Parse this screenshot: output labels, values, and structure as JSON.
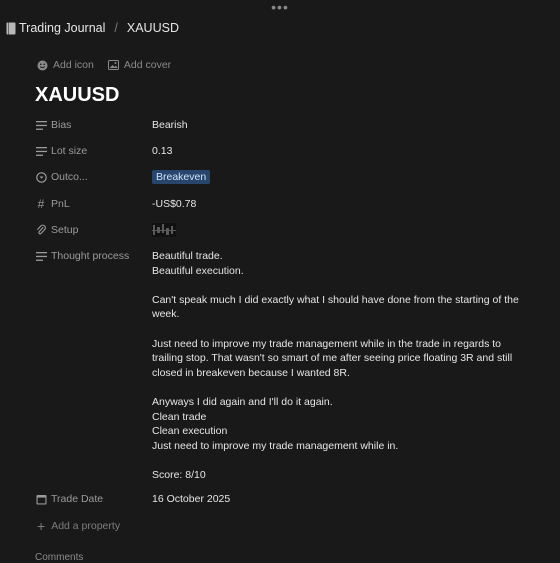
{
  "breadcrumb": {
    "parent": "Trading Journal",
    "separator": "/",
    "current": "XAUUSD"
  },
  "page_actions": {
    "add_icon": "Add icon",
    "add_cover": "Add cover"
  },
  "title": "XAUUSD",
  "properties": {
    "bias": {
      "label": "Bias",
      "value": "Bearish"
    },
    "lot_size": {
      "label": "Lot size",
      "value": "0.13"
    },
    "outcome": {
      "label": "Outco...",
      "value": "Breakeven"
    },
    "pnl": {
      "label": "PnL",
      "value": "-US$0.78"
    },
    "setup": {
      "label": "Setup"
    },
    "thought_process": {
      "label": "Thought process",
      "lines": [
        "Beautiful trade.",
        "Beautiful execution.",
        "",
        "Can't speak much I did exactly what I should have done from the starting of the week.",
        "",
        "Just need to improve my trade management while in the trade in regards to trailing stop. That wasn't so smart of me after seeing price floating 3R and still closed in breakeven because I wanted 8R.",
        "",
        "Anyways I did again and I'll do it again.",
        "Clean trade",
        "Clean execution",
        "Just need to improve my trade management while in.",
        "",
        "Score: 8/10"
      ]
    },
    "trade_date": {
      "label": "Trade Date",
      "value": "16 October 2025"
    }
  },
  "add_property": "Add a property",
  "comments_label": "Comments",
  "colors": {
    "background": "#191919",
    "badge_bg": "#28456c",
    "badge_text": "#cfe2ff"
  }
}
